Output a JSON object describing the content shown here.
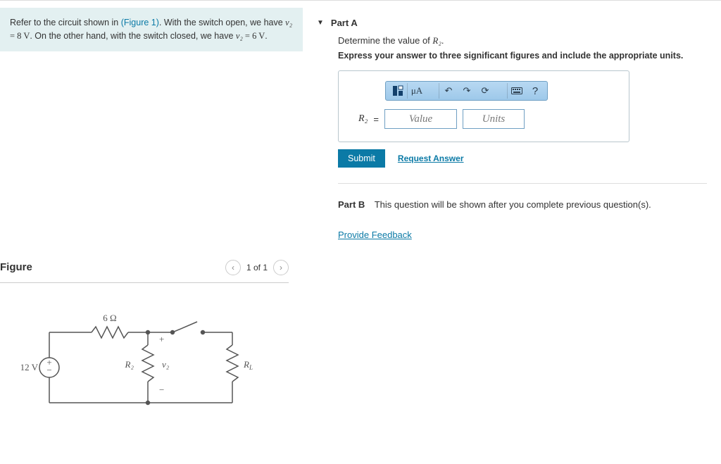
{
  "problem": {
    "text_prefix": "Refer to the circuit shown in ",
    "figure_link_text": "(Figure 1)",
    "text_mid": ". With the switch open, we have ",
    "v2_open": "= 8 V",
    "text_mid2": ". On the other hand, with the switch closed, we have ",
    "v2_closed": "= 6 V",
    "text_end": ".",
    "v2_symbol": "v₂"
  },
  "figure": {
    "title": "Figure",
    "pager": "1 of 1",
    "circuit": {
      "source_voltage": "12 V",
      "resistor_top": "6 Ω",
      "r2_label": "R₂",
      "v2_label": "v₂",
      "rl_label": "R",
      "rl_sub": "L"
    }
  },
  "partA": {
    "header": "Part A",
    "prompt": "Determine the value of ",
    "prompt_var": "R₂",
    "instruction": "Express your answer to three significant figures and include the appropriate units.",
    "toolbar_mu": "μA",
    "toolbar_q": "?",
    "varname": "R₂",
    "eq": "=",
    "value_placeholder": "Value",
    "units_placeholder": "Units",
    "submit": "Submit",
    "request_answer": "Request Answer"
  },
  "partB": {
    "label": "Part B",
    "text": "This question will be shown after you complete previous question(s)."
  },
  "feedback": "Provide Feedback"
}
